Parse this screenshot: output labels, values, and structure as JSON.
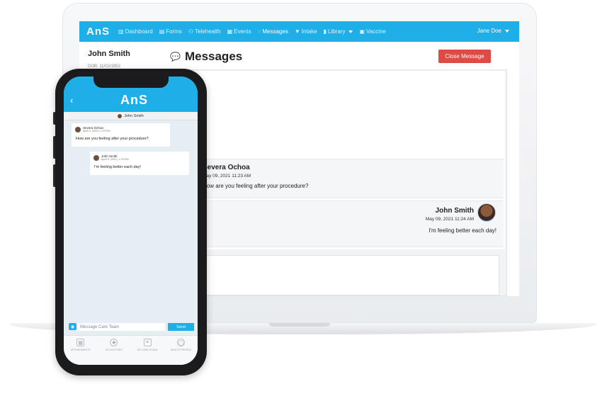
{
  "app": {
    "brand": "AnS",
    "nav": [
      {
        "icon": "chart-icon",
        "glyph": "▥",
        "label": "Dashboard",
        "active": false
      },
      {
        "icon": "form-icon",
        "glyph": "▤",
        "label": "Forms",
        "active": false
      },
      {
        "icon": "people-icon",
        "glyph": "⚇",
        "label": "Telehealth",
        "active": false
      },
      {
        "icon": "calendar-icon",
        "glyph": "▦",
        "label": "Events",
        "active": false
      },
      {
        "icon": "chat-icon",
        "glyph": "◌",
        "label": "Messages",
        "active": true
      },
      {
        "icon": "filter-icon",
        "glyph": "▼",
        "label": "Intake",
        "active": false
      },
      {
        "icon": "book-icon",
        "glyph": "▮",
        "label": "Library",
        "active": false
      },
      {
        "icon": "briefcase-icon",
        "glyph": "▣",
        "label": "Vaccine",
        "active": false
      }
    ],
    "user": "Jane Doe"
  },
  "patient": {
    "name": "John  Smith",
    "dob": "DOB: 11/02/1952"
  },
  "messages_page": {
    "title": "Messages",
    "close_button": "Close Message",
    "items": [
      {
        "sender": "Severa Ochoa",
        "time": "May 09, 2021 11:23 AM",
        "body": "How are you feeling after your procedure?"
      },
      {
        "sender": "John Smith",
        "time": "May 09, 2021 11:24 AM",
        "body": "I'm feeling better each day!"
      }
    ]
  },
  "phone": {
    "logo": "AnS",
    "back": "‹",
    "conversation_with": "John Smith",
    "messages": [
      {
        "sender": "Severa Ochoa",
        "time": "April 9, 2020 | 1:23 PM",
        "body": "How are you feeling after your procedure?"
      },
      {
        "sender": "John Smith",
        "time": "April 9, 2020 | 1:23 PM",
        "body": "I'm feeling better each day!"
      }
    ],
    "input_placeholder": "Message Care Team",
    "send_label": "Send",
    "tabs": [
      {
        "icon": "calendar-icon",
        "glyph": "▦",
        "label": "APPOINTMENTS"
      },
      {
        "icon": "doctor-icon",
        "glyph": "✚",
        "label": "MY DOCTORS"
      },
      {
        "icon": "document-icon",
        "glyph": "≡",
        "label": "MY CARE PLANS"
      },
      {
        "icon": "user-icon",
        "glyph": "◯",
        "label": "HEALTH PROFILE"
      }
    ]
  },
  "colors": {
    "primary": "#1eaee8",
    "danger": "#dc4b45"
  }
}
